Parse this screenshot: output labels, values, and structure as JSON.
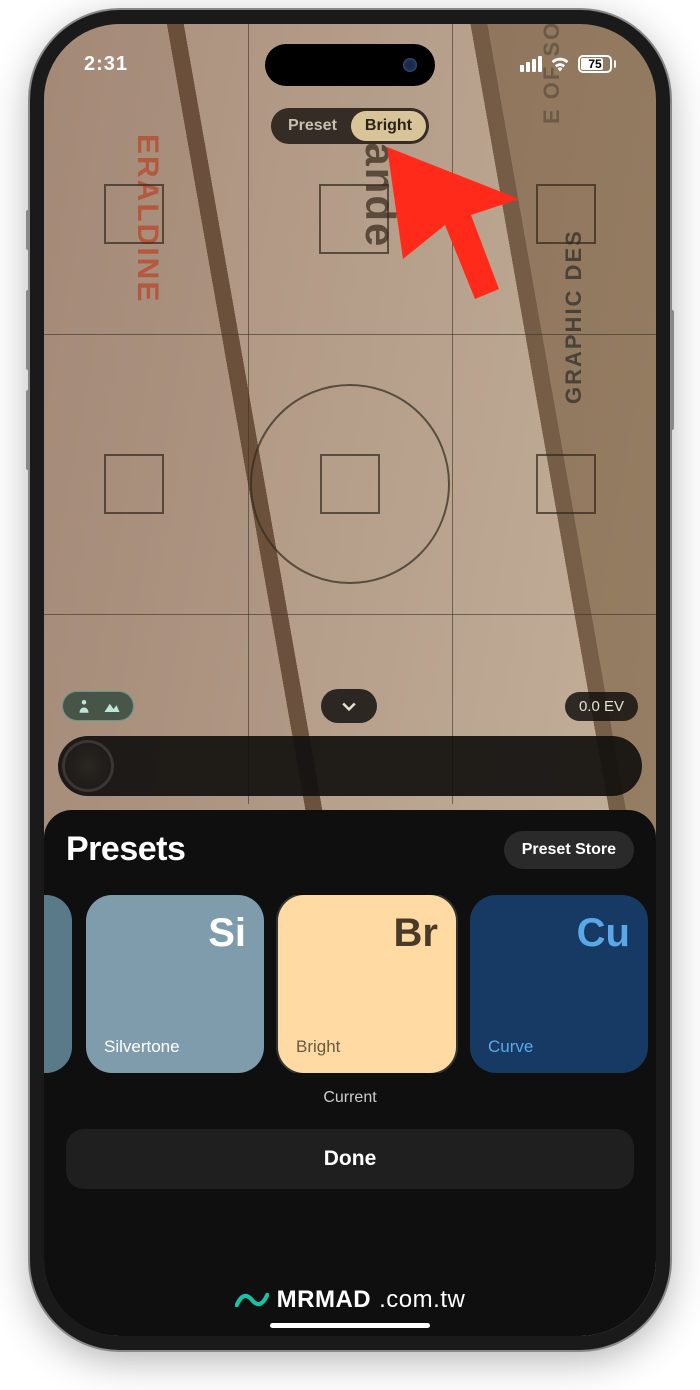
{
  "status": {
    "time": "2:31",
    "battery_pct": "75"
  },
  "mode_pill": {
    "left": "Preset",
    "right": "Bright"
  },
  "controls": {
    "ev": "0.0 EV"
  },
  "sheet": {
    "title": "Presets",
    "store": "Preset Store",
    "current_label": "Current",
    "done": "Done"
  },
  "presets": {
    "silver": {
      "symbol": "Si",
      "name": "Silvertone"
    },
    "bright": {
      "symbol": "Br",
      "name": "Bright"
    },
    "curve": {
      "symbol": "Cu",
      "name": "Curve"
    }
  },
  "watermark": {
    "brand": "MRMAD",
    "domain": ".com.tw"
  },
  "bg_text": {
    "t1": "ERALDINE",
    "t2": "rande",
    "t3": "GRAPHIC DES",
    "t4": "E OF SOAKI"
  }
}
